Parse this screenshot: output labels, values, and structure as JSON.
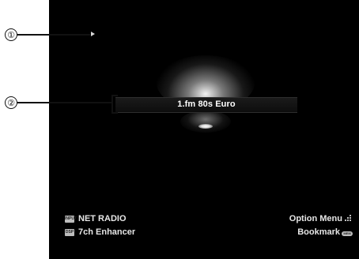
{
  "callouts": {
    "one": "①",
    "two": "②"
  },
  "screen": {
    "playback_state_icon": "play-icon",
    "station_name": "1.fm 80s Euro"
  },
  "status": {
    "input_key": "INPUT",
    "input_label": "NET RADIO",
    "dsp_key": "DSP",
    "dsp_label": "7ch Enhancer"
  },
  "actions": {
    "option_label": "Option Menu",
    "option_icon": "option-grid-icon",
    "bookmark_label": "Bookmark",
    "bookmark_key": "MEM"
  },
  "colors": {
    "screen_background": "#000000",
    "text": "#e6e6e6",
    "chip": "#bdbdbd"
  }
}
